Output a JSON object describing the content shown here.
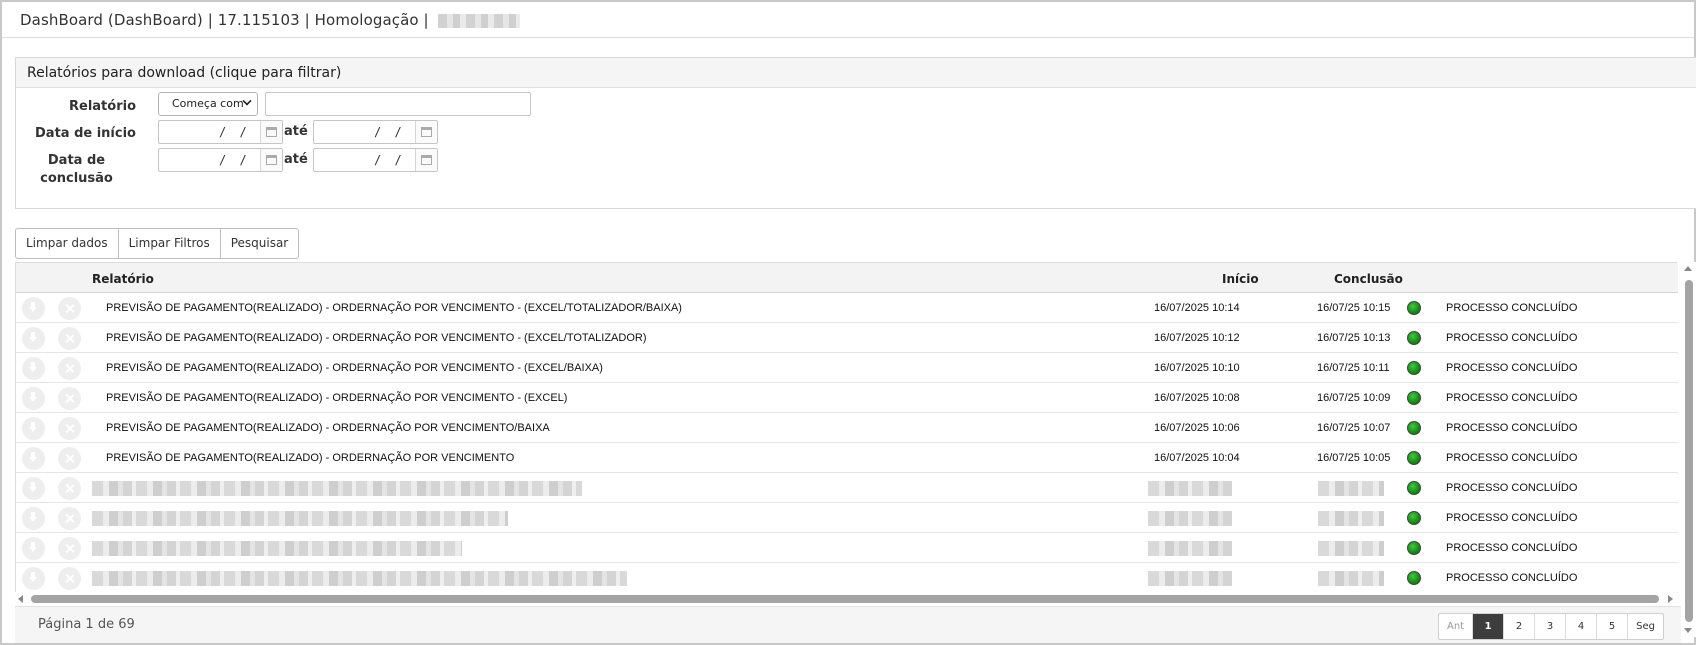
{
  "window": {
    "title": "DashBoard (DashBoard) | 17.115103 | Homologação |"
  },
  "filter_panel": {
    "header": "Relatórios para download (clique para filtrar)",
    "relatorio_label": "Relatório",
    "relatorio_operator": "Começa com",
    "relatorio_value": "",
    "data_inicio_label": "Data de início",
    "data_conclusao_label": "Data de conclusão",
    "date_mask": "/ /",
    "ate_label": "até"
  },
  "toolbar": {
    "limpar_dados": "Limpar dados",
    "limpar_filtros": "Limpar Filtros",
    "pesquisar": "Pesquisar"
  },
  "grid": {
    "columns": {
      "relatorio": "Relatório",
      "inicio": "Início",
      "conclusao": "Conclusão"
    },
    "status_color": "#169116",
    "rows": [
      {
        "relatorio": "PREVISÃO DE PAGAMENTO(REALIZADO) - ORDERNAÇÃO POR VENCIMENTO - (EXCEL/TOTALIZADOR/BAIXA)",
        "inicio": "16/07/2025 10:14",
        "conclusao": "16/07/25 10:15",
        "status": "PROCESSO CONCLUÍDO"
      },
      {
        "relatorio": "PREVISÃO DE PAGAMENTO(REALIZADO) - ORDERNAÇÃO POR VENCIMENTO - (EXCEL/TOTALIZADOR)",
        "inicio": "16/07/2025 10:12",
        "conclusao": "16/07/25 10:13",
        "status": "PROCESSO CONCLUÍDO"
      },
      {
        "relatorio": "PREVISÃO DE PAGAMENTO(REALIZADO) - ORDERNAÇÃO POR VENCIMENTO - (EXCEL/BAIXA)",
        "inicio": "16/07/2025 10:10",
        "conclusao": "16/07/25 10:11",
        "status": "PROCESSO CONCLUÍDO"
      },
      {
        "relatorio": "PREVISÃO DE PAGAMENTO(REALIZADO) - ORDERNAÇÃO POR VENCIMENTO - (EXCEL)",
        "inicio": "16/07/2025 10:08",
        "conclusao": "16/07/25 10:09",
        "status": "PROCESSO CONCLUÍDO"
      },
      {
        "relatorio": "PREVISÃO DE PAGAMENTO(REALIZADO) - ORDERNAÇÃO POR VENCIMENTO/BAIXA",
        "inicio": "16/07/2025 10:06",
        "conclusao": "16/07/25 10:07",
        "status": "PROCESSO CONCLUÍDO"
      },
      {
        "relatorio": "PREVISÃO DE PAGAMENTO(REALIZADO) - ORDERNAÇÃO POR VENCIMENTO",
        "inicio": "16/07/2025 10:04",
        "conclusao": "16/07/25 10:05",
        "status": "PROCESSO CONCLUÍDO"
      },
      {
        "status": "PROCESSO CONCLUÍDO"
      },
      {
        "status": "PROCESSO CONCLUÍDO"
      },
      {
        "status": "PROCESSO CONCLUÍDO"
      },
      {
        "status": "PROCESSO CONCLUÍDO"
      }
    ]
  },
  "pagination": {
    "info": "Página 1 de 69",
    "prev": "Ant",
    "pages": [
      "1",
      "2",
      "3",
      "4",
      "5"
    ],
    "next": "Seg",
    "active_page": "1"
  }
}
